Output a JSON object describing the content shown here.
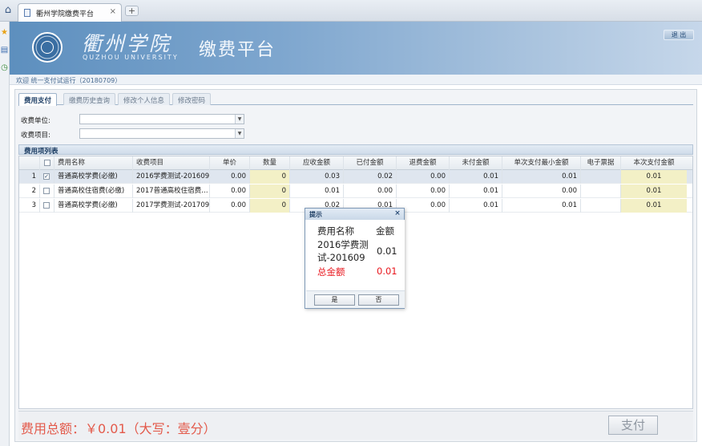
{
  "browser": {
    "tab_title": "衢州学院缴费平台",
    "tab_close": "×",
    "new_tab": "+"
  },
  "banner": {
    "university_cn": "衢州学院",
    "university_en": "QUZHOU UNIVERSITY",
    "platform_title": "缴费平台",
    "logout_label": "退 出"
  },
  "welcome": "欢迎 统一支付试运行（20180709）",
  "tabs": [
    {
      "label": "费用支付",
      "active": true
    },
    {
      "label": "缴费历史查询",
      "active": false
    },
    {
      "label": "修改个人信息",
      "active": false
    },
    {
      "label": "修改密码",
      "active": false
    }
  ],
  "filters": {
    "unit_label": "收费单位:",
    "item_label": "收费项目:",
    "unit_value": "",
    "item_value": ""
  },
  "section_title": "费用项列表",
  "grid": {
    "columns": [
      "",
      "",
      "费用名称",
      "收费项目",
      "单价",
      "数量",
      "应收金额",
      "已付金额",
      "退费金额",
      "未付金额",
      "单次支付最小金额",
      "电子票据",
      "本次支付金额"
    ],
    "rows": [
      {
        "index": "1",
        "checked": true,
        "fee_name": "普通高校学费(必缴)",
        "item": "2016学费测试-201609",
        "price": "0.00",
        "qty": "0",
        "due": "0.03",
        "paid": "0.02",
        "refund": "0.00",
        "unpaid": "0.01",
        "min_pay": "0.01",
        "ticket": "",
        "this_pay": "0.01"
      },
      {
        "index": "2",
        "checked": false,
        "fee_name": "普通高校住宿费(必缴)",
        "item": "2017普通高校住宿费…",
        "price": "0.00",
        "qty": "0",
        "due": "0.01",
        "paid": "0.00",
        "refund": "0.00",
        "unpaid": "0.01",
        "min_pay": "0.00",
        "ticket": "",
        "this_pay": "0.01"
      },
      {
        "index": "3",
        "checked": false,
        "fee_name": "普通高校学费(必缴)",
        "item": "2017学费测试-201709",
        "price": "0.00",
        "qty": "0",
        "due": "0.02",
        "paid": "0.01",
        "refund": "0.00",
        "unpaid": "0.01",
        "min_pay": "0.01",
        "ticket": "",
        "this_pay": "0.01"
      }
    ]
  },
  "footer": {
    "total_text": "费用总额：￥0.01（大写：壹分）",
    "pay_label": "支付"
  },
  "dialog": {
    "title": "提示",
    "close": "×",
    "col_name": "费用名称",
    "col_amount": "金额",
    "item_name_line1": "2016学费测",
    "item_name_line2": "试-201609",
    "item_amount": "0.01",
    "total_label": "总金额",
    "total_amount": "0.01",
    "yes_label": "是",
    "no_label": "否",
    "accent_color": "#e8151c"
  }
}
